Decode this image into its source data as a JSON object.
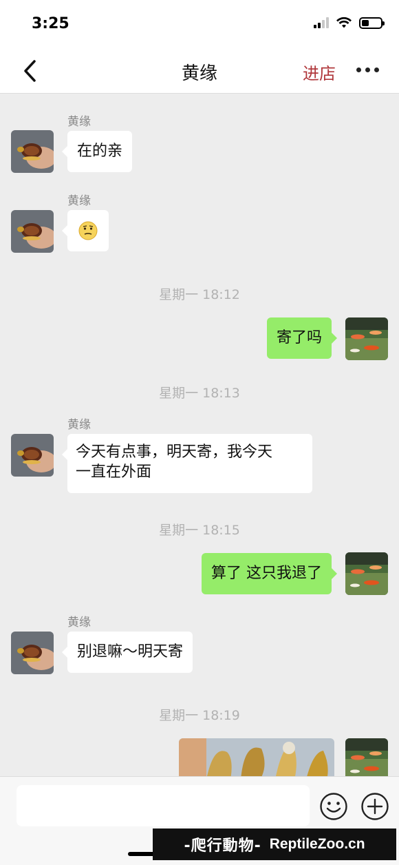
{
  "status_bar": {
    "time": "3:25"
  },
  "header": {
    "title": "黄缘",
    "shop_label": "进店",
    "back_icon": "chevron-left-icon",
    "more_icon": "more-dots-icon"
  },
  "messages": [
    {
      "type": "incoming",
      "sender": "黄缘",
      "text": "在的亲"
    },
    {
      "type": "incoming",
      "sender": "黄缘",
      "text": "",
      "emoji": "awkward-smile-emoji"
    },
    {
      "type": "timestamp",
      "text": "星期一 18:12"
    },
    {
      "type": "outgoing",
      "text": "寄了吗"
    },
    {
      "type": "timestamp",
      "text": "星期一 18:13"
    },
    {
      "type": "incoming",
      "sender": "黄缘",
      "text_line1": "今天有点事，明天寄，我今天",
      "text_line2": "一直在外面"
    },
    {
      "type": "timestamp",
      "text": "星期一 18:15"
    },
    {
      "type": "outgoing",
      "text": "算了 这只我退了"
    },
    {
      "type": "incoming",
      "sender": "黄缘",
      "text": "别退嘛～明天寄"
    },
    {
      "type": "timestamp",
      "text": "星期一 18:19"
    },
    {
      "type": "outgoing-image",
      "text": ""
    }
  ],
  "input_bar": {
    "placeholder": "",
    "emoji_icon": "smiley-face-icon",
    "plus_icon": "plus-circle-icon"
  },
  "watermark": {
    "cn": "-爬行動物-",
    "en": "ReptileZoo.cn"
  },
  "colors": {
    "outgoing_bubble": "#95ec69",
    "incoming_bubble": "#ffffff",
    "chat_background": "#ededed",
    "shop_link": "#b0373b"
  }
}
